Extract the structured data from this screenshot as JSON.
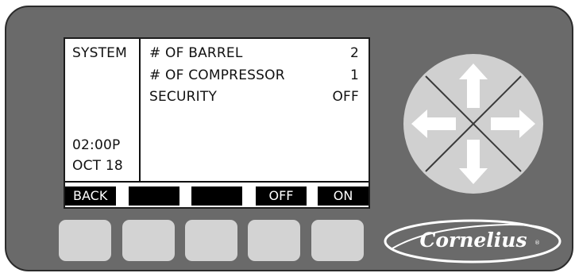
{
  "screen": {
    "menu_title": "SYSTEM",
    "time": "02:00P",
    "date": "OCT 18",
    "settings": [
      {
        "label": "# OF BARREL",
        "value": "2"
      },
      {
        "label": "# OF COMPRESSOR",
        "value": "1"
      },
      {
        "label": "SECURITY",
        "value": "OFF"
      }
    ],
    "softkeys": [
      "BACK",
      "",
      "",
      "OFF",
      "ON"
    ]
  },
  "dpad": {
    "directions": [
      "up",
      "right",
      "down",
      "left"
    ]
  },
  "branding": {
    "logo_text": "Cornelius",
    "registered_mark": "®"
  },
  "colors": {
    "panel": "#6a6a6a",
    "button": "#d3d3d3",
    "dpad": "#d0d0d0",
    "softkey_bar": "#000000"
  }
}
